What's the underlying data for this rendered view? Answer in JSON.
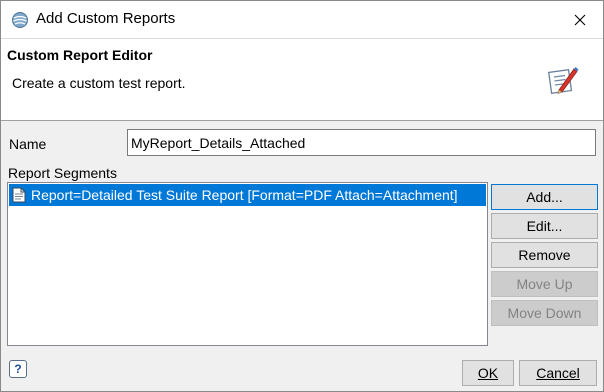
{
  "window": {
    "title": "Add Custom Reports"
  },
  "header": {
    "title": "Custom Report Editor",
    "description": "Create a custom test report."
  },
  "form": {
    "name_label": "Name",
    "name_value": "MyReport_Details_Attached",
    "segments_label": "Report Segments",
    "segments": [
      {
        "text": "Report=Detailed Test Suite Report [Format=PDF Attach=Attachment]",
        "selected": true
      }
    ]
  },
  "buttons": {
    "add": "Add...",
    "edit": "Edit...",
    "remove": "Remove",
    "move_up": "Move Up",
    "move_down": "Move Down",
    "ok": "OK",
    "cancel": "Cancel"
  },
  "icons": {
    "app": "eclipse-globe-icon",
    "close": "close-icon",
    "editor": "report-edit-icon",
    "document": "document-icon",
    "help": "help-icon"
  },
  "colors": {
    "selection": "#0078d7",
    "default_button_border": "#0078d7",
    "disabled_text": "#838383"
  }
}
